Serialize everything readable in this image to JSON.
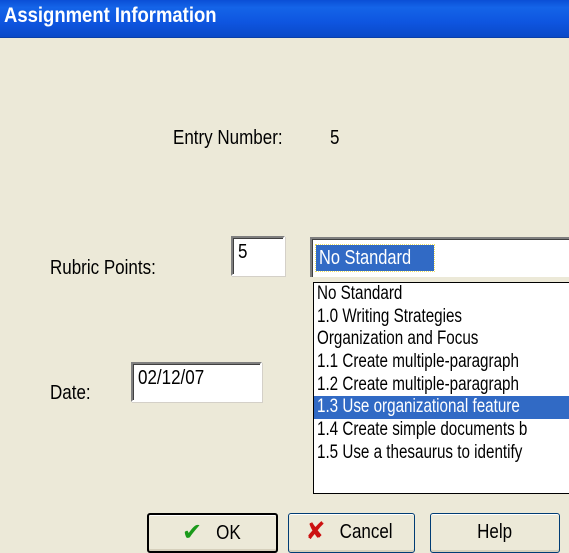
{
  "window": {
    "title": "Assignment Information"
  },
  "entry": {
    "label": "Entry Number:",
    "value": "5"
  },
  "rubric": {
    "label": "Rubric Points:",
    "value": "5"
  },
  "date": {
    "label": "Date:",
    "value": "02/12/07"
  },
  "standard": {
    "selected": "No Standard",
    "options": [
      "No Standard",
      "1.0  Writing Strategies",
      " Organization and Focus",
      "1.1  Create multiple-paragraph",
      "1.2  Create multiple-paragraph",
      "1.3  Use organizational feature",
      "1.4  Create simple documents b",
      "1.5  Use a thesaurus to identify"
    ],
    "highlighted_index": 5
  },
  "buttons": {
    "ok": "OK",
    "cancel": "Cancel",
    "help": "Help"
  },
  "icons": {
    "ok": "check-icon",
    "cancel": "x-icon"
  },
  "colors": {
    "titlebar": "#0a4fd6",
    "selection": "#316ac5",
    "dialog_bg": "#ece9d8"
  }
}
